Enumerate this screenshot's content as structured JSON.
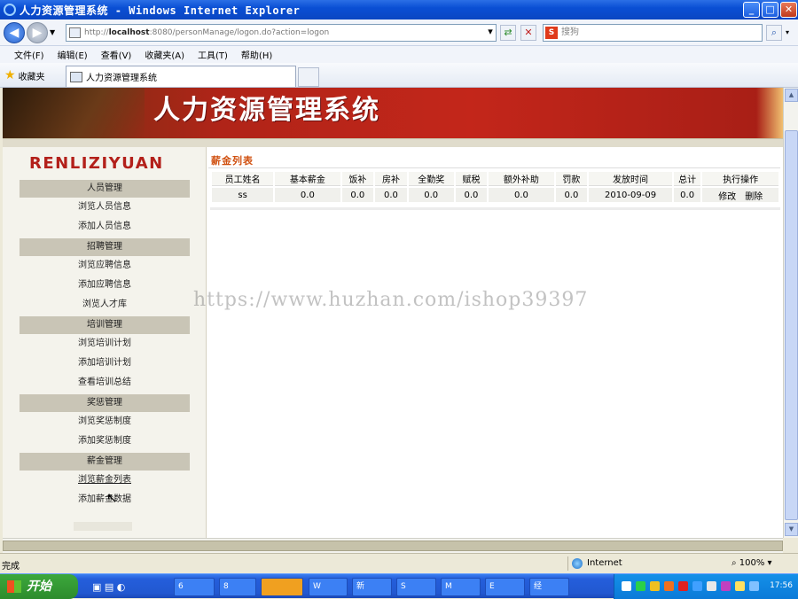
{
  "window": {
    "title": "人力资源管理系统 - Windows Internet Explorer"
  },
  "address": {
    "prefix": "http://",
    "host": "localhost",
    "rest": ":8080/personManage/logon.do?action=logon"
  },
  "search": {
    "placeholder": "搜狗",
    "engine_glyph": "S"
  },
  "menu": [
    "文件(F)",
    "编辑(E)",
    "查看(V)",
    "收藏夹(A)",
    "工具(T)",
    "帮助(H)"
  ],
  "favorites": {
    "label": "收藏夹"
  },
  "tab": {
    "title": "人力资源管理系统"
  },
  "banner": {
    "title": "人力资源管理系统"
  },
  "sidebar": {
    "brand": "RENLIZIYUAN",
    "sections": [
      {
        "title": "人员管理",
        "items": [
          "浏览人员信息",
          "添加人员信息"
        ]
      },
      {
        "title": "招聘管理",
        "items": [
          "浏览应聘信息",
          "添加应聘信息",
          "浏览人才库"
        ]
      },
      {
        "title": "培训管理",
        "items": [
          "浏览培训计划",
          "添加培训计划",
          "查看培训总结"
        ]
      },
      {
        "title": "奖惩管理",
        "items": [
          "浏览奖惩制度",
          "添加奖惩制度"
        ]
      },
      {
        "title": "薪金管理",
        "items": [
          "浏览薪金列表",
          "添加薪金数据"
        ]
      }
    ]
  },
  "salary": {
    "heading": "薪金列表",
    "columns": [
      "员工姓名",
      "基本薪金",
      "饭补",
      "房补",
      "全勤奖",
      "赋税",
      "额外补助",
      "罚款",
      "发放时间",
      "总计",
      "执行操作"
    ],
    "rows": [
      {
        "name": "ss",
        "base": "0.0",
        "meal": "0.0",
        "housing": "0.0",
        "attendance": "0.0",
        "tax": "0.0",
        "extra": "0.0",
        "fine": "0.0",
        "date": "2010-09-09",
        "total": "0.0",
        "edit": "修改",
        "delete": "删除"
      }
    ]
  },
  "watermark": "https://www.huzhan.com/ishop39397",
  "status": {
    "text": "完成",
    "zone": "Internet",
    "zoom": "100%"
  },
  "taskbar": {
    "start": "开始",
    "tasks": [
      "6",
      "8",
      "",
      "W",
      "新",
      "S",
      "M",
      "E",
      "经"
    ],
    "clock": "17:56"
  }
}
